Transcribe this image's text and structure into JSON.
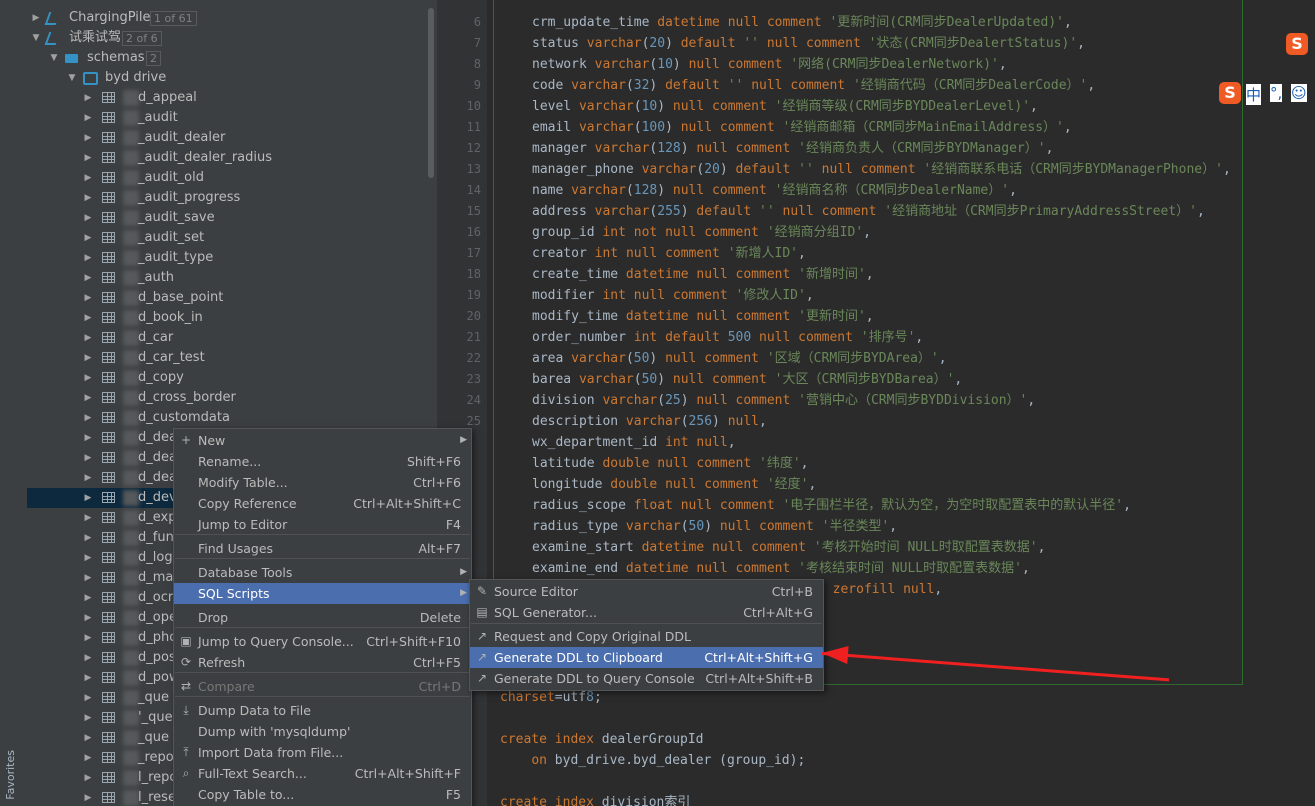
{
  "favorites_label": "Favorites",
  "tree": {
    "items": [
      {
        "name": "ChargingPile",
        "count": "1 of 61"
      },
      {
        "name": "试乘试驾",
        "count": "2 of 6"
      },
      {
        "name": "schemas",
        "count": "2"
      },
      {
        "name": "byd drive"
      },
      {
        "name": "d_appeal"
      },
      {
        "name": "_audit"
      },
      {
        "name": "_audit_dealer"
      },
      {
        "name": "_audit_dealer_radius"
      },
      {
        "name": "_audit_old"
      },
      {
        "name": "_audit_progress"
      },
      {
        "name": "_audit_save"
      },
      {
        "name": "_audit_set"
      },
      {
        "name": "_audit_type"
      },
      {
        "name": "_auth"
      },
      {
        "name": "d_base_point"
      },
      {
        "name": "d_book_in"
      },
      {
        "name": "d_car"
      },
      {
        "name": "d_car_test"
      },
      {
        "name": "d_copy"
      },
      {
        "name": "d_cross_border"
      },
      {
        "name": "d_customdata"
      },
      {
        "name": "d_dea"
      },
      {
        "name": "d_dea"
      },
      {
        "name": "d_dea"
      },
      {
        "name": "d_dev"
      },
      {
        "name": "d_exp"
      },
      {
        "name": "d_func"
      },
      {
        "name": "d_logi"
      },
      {
        "name": "d_mar"
      },
      {
        "name": "d_ocr"
      },
      {
        "name": "d_ope"
      },
      {
        "name": "d_pho"
      },
      {
        "name": "d_pos"
      },
      {
        "name": "d_pow"
      },
      {
        "name": "_que"
      },
      {
        "name": "'_que"
      },
      {
        "name": "_que"
      },
      {
        "name": "_repo"
      },
      {
        "name": "l_repo"
      },
      {
        "name": "l_rese"
      }
    ]
  },
  "editor": {
    "line_numbers": [
      "6",
      "7",
      "8",
      "9",
      "10",
      "11",
      "12",
      "13",
      "14",
      "15",
      "16",
      "17",
      "18",
      "19",
      "20",
      "21",
      "22",
      "23",
      "24",
      "25"
    ],
    "lines": [
      "crm_update_time datetime null comment '更新时间(CRM同步DealerUpdated)',",
      "status varchar(20) default '' null comment '状态(CRM同步DealertStatus)',",
      "network varchar(10) null comment '网络(CRM同步DealerNetwork)',",
      "code varchar(32) default '' null comment '经销商代码（CRM同步DealerCode）',",
      "level varchar(10) null comment '经销商等级(CRM同步BYDDealerLevel)',",
      "email varchar(100) null comment '经销商邮箱（CRM同步MainEmailAddress）',",
      "manager varchar(128) null comment '经销商负责人（CRM同步BYDManager）',",
      "manager_phone varchar(20) default '' null comment '经销商联系电话（CRM同步BYDManagerPhone）',",
      "name varchar(128) null comment '经销商名称（CRM同步DealerName）',",
      "address varchar(255) default '' null comment '经销商地址（CRM同步PrimaryAddressStreet）',",
      "group_id int not null comment '经销商分组ID',",
      "creator int null comment '新增人ID',",
      "create_time datetime null comment '新增时间',",
      "modifier int null comment '修改人ID',",
      "modify_time datetime null comment '更新时间',",
      "order_number int default 500 null comment '排序号',",
      "area varchar(50) null comment '区域（CRM同步BYDArea）',",
      "barea varchar(50) null comment '大区（CRM同步BYDBarea）',",
      "division varchar(25) null comment '营销中心（CRM同步BYDDivision）',",
      "description varchar(256) null,",
      "wx_department_id int null,",
      "latitude double null comment '纬度',",
      "longitude double null comment '经度',",
      "radius_scope float null comment '电子围栏半径，默认为空，为空时取配置表中的默认半径',",
      "radius_type varchar(50) null comment '半径类型',",
      "examine_start datetime null comment '考核开始时间 NULL时取配置表数据',",
      "examine_end datetime null comment '考核结束时间 NULL时取配置表数据',",
      "d zerofill null,"
    ],
    "tail_lines": [
      "charset=utf8;",
      "create index dealerGroupId",
      "    on byd_drive.byd_dealer (group_id);",
      "create index division索引"
    ]
  },
  "ime": {
    "badge": "S",
    "lang": "中",
    "punct": "°,",
    "emoji": "☺"
  },
  "context_menu": {
    "items": [
      {
        "label": "New",
        "shortcut": "",
        "icon": "plus-icon",
        "submenu": true
      },
      {
        "label": "Rename...",
        "shortcut": "Shift+F6"
      },
      {
        "label": "Modify Table...",
        "shortcut": "Ctrl+F6"
      },
      {
        "label": "Copy Reference",
        "shortcut": "Ctrl+Alt+Shift+C"
      },
      {
        "label": "Jump to Editor",
        "shortcut": "F4"
      },
      {
        "label": "Find Usages",
        "shortcut": "Alt+F7"
      },
      {
        "label": "Database Tools",
        "shortcut": "",
        "submenu": true
      },
      {
        "label": "SQL Scripts",
        "shortcut": "",
        "submenu": true
      },
      {
        "label": "Drop",
        "shortcut": "Delete"
      },
      {
        "label": "Jump to Query Console...",
        "shortcut": "Ctrl+Shift+F10",
        "icon": "console-icon"
      },
      {
        "label": "Refresh",
        "shortcut": "Ctrl+F5",
        "icon": "refresh-icon"
      },
      {
        "label": "Compare",
        "shortcut": "Ctrl+D",
        "icon": "compare-icon",
        "disabled": true
      },
      {
        "label": "Dump Data to File",
        "shortcut": "",
        "icon": "download-icon"
      },
      {
        "label": "Dump with 'mysqldump'",
        "shortcut": ""
      },
      {
        "label": "Import Data from File...",
        "shortcut": "",
        "icon": "import-icon"
      },
      {
        "label": "Full-Text Search...",
        "shortcut": "Ctrl+Alt+Shift+F",
        "icon": "search-icon"
      },
      {
        "label": "Copy Table to...",
        "shortcut": "F5"
      }
    ]
  },
  "submenu": {
    "items": [
      {
        "label": "Source Editor",
        "shortcut": "Ctrl+B",
        "icon": "edit-icon"
      },
      {
        "label": "SQL Generator...",
        "shortcut": "Ctrl+Alt+G",
        "icon": "sql-icon"
      },
      {
        "label": "Request and Copy Original DDL",
        "shortcut": "",
        "icon": "external-icon"
      },
      {
        "label": "Generate DDL to Clipboard",
        "shortcut": "Ctrl+Alt+Shift+G",
        "icon": "external-icon"
      },
      {
        "label": "Generate DDL to Query Console",
        "shortcut": "Ctrl+Alt+Shift+B",
        "icon": "external-icon"
      }
    ]
  },
  "colors": {
    "highlight": "#4b6eaf",
    "arrow": "#f02020",
    "keyword": "#cc7832",
    "string": "#6a8759"
  }
}
